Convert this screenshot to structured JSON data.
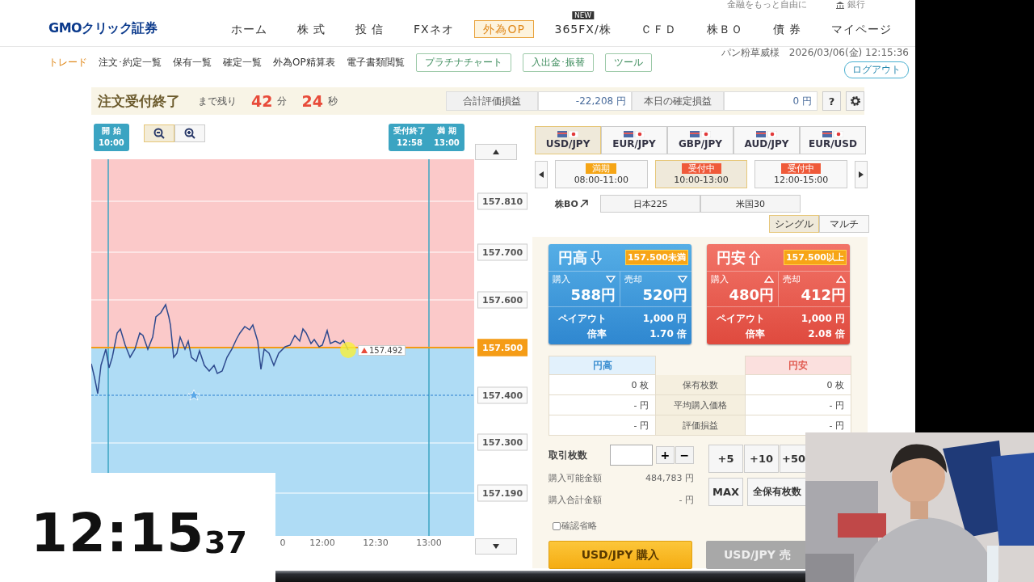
{
  "top_strip": {
    "tagline": "金融をもっと自由に",
    "bank_link": "銀行"
  },
  "header": {
    "logo": "GMOクリック証券",
    "nav": [
      {
        "label": "ホーム",
        "selected": false
      },
      {
        "label": "株 式",
        "selected": false
      },
      {
        "label": "投 信",
        "selected": false
      },
      {
        "label": "FXネオ",
        "selected": false
      },
      {
        "label": "外為OP",
        "selected": true
      },
      {
        "label": "365FX/株",
        "selected": false,
        "badge": "NEW"
      },
      {
        "label": "ＣＦＤ",
        "selected": false
      },
      {
        "label": "株ＢＯ",
        "selected": false
      },
      {
        "label": "債 券",
        "selected": false
      },
      {
        "label": "マイページ",
        "selected": false
      }
    ]
  },
  "subnav": {
    "items": [
      {
        "label": "トレード",
        "selected": true
      },
      {
        "label": "注文･約定一覧",
        "selected": false
      },
      {
        "label": "保有一覧",
        "selected": false
      },
      {
        "label": "確定一覧",
        "selected": false
      },
      {
        "label": "外為OP精算表",
        "selected": false
      },
      {
        "label": "電子書類閲覧",
        "selected": false
      }
    ],
    "buttons": [
      "プラチナチャート",
      "入出金･振替",
      "ツール"
    ],
    "user": "パン粉草威様",
    "datetime": "2026/03/06(金) 12:15:36",
    "logout": "ログアウト"
  },
  "status": {
    "title": "注文受付終了",
    "remaining_label": "まで残り",
    "minutes": "42",
    "minutes_unit": "分",
    "seconds": "24",
    "seconds_unit": "秒",
    "total_pl_label": "合計評価損益",
    "total_pl": "-22,208 円",
    "today_pl_label": "本日の確定損益",
    "today_pl": "0 円",
    "help": "?"
  },
  "chart": {
    "start_flag": {
      "title": "開 始",
      "time": "10:00"
    },
    "end_flag": {
      "title": "受付終了",
      "time": "12:58",
      "title2": "満 期",
      "time2": "13:00"
    },
    "y_labels": [
      {
        "label": "157.810",
        "highlight": false
      },
      {
        "label": "157.700",
        "highlight": false
      },
      {
        "label": "157.600",
        "highlight": false
      },
      {
        "label": "157.500",
        "highlight": true
      },
      {
        "label": "157.400",
        "highlight": false
      },
      {
        "label": "157.300",
        "highlight": false
      },
      {
        "label": "157.190",
        "highlight": false
      }
    ],
    "x_labels": [
      "0",
      "12:00",
      "12:30",
      "13:00"
    ],
    "current_price": "157.492"
  },
  "pairs": [
    {
      "label": "USD/JPY",
      "selected": true
    },
    {
      "label": "EUR/JPY",
      "selected": false
    },
    {
      "label": "GBP/JPY",
      "selected": false
    },
    {
      "label": "AUD/JPY",
      "selected": false
    },
    {
      "label": "EUR/USD",
      "selected": false
    }
  ],
  "sessions": [
    {
      "status": "満期",
      "time": "08:00-11:00",
      "kind": "expired",
      "selected": false
    },
    {
      "status": "受付中",
      "time": "10:00-13:00",
      "kind": "open",
      "selected": true
    },
    {
      "status": "受付中",
      "time": "12:00-15:00",
      "kind": "open",
      "selected": false
    }
  ],
  "stock_bo": {
    "label": "株BO",
    "buttons": [
      "日本225",
      "米国30"
    ]
  },
  "modes": [
    {
      "label": "シングル",
      "selected": true
    },
    {
      "label": "マルチ",
      "selected": false
    }
  ],
  "cards": [
    {
      "kind": "high",
      "title": "円高",
      "threshold": "157.500未満",
      "buy_label": "購入",
      "buy_price": "588円",
      "sell_label": "売却",
      "sell_price": "520円",
      "payout_label": "ペイアウト",
      "payout": "1,000 円",
      "rate_label": "倍率",
      "rate": "1.70 倍"
    },
    {
      "kind": "low",
      "title": "円安",
      "threshold": "157.500以上",
      "buy_label": "購入",
      "buy_price": "480円",
      "sell_label": "売却",
      "sell_price": "412円",
      "payout_label": "ペイアウト",
      "payout": "1,000 円",
      "rate_label": "倍率",
      "rate": "2.08 倍"
    }
  ],
  "positions": {
    "left_header": "円高",
    "right_header": "円安",
    "rows": [
      {
        "left": "0 枚",
        "label": "保有枚数",
        "right": "0 枚"
      },
      {
        "left": "- 円",
        "label": "平均購入価格",
        "right": "- 円"
      },
      {
        "left": "- 円",
        "label": "評価損益",
        "right": "- 円"
      }
    ]
  },
  "order": {
    "qty_label": "取引枚数",
    "plus": "+",
    "minus": "−",
    "quick": [
      "+5",
      "+10",
      "+50"
    ],
    "max": "MAX",
    "all": "全保有枚数",
    "available_label": "購入可能金額",
    "available": "484,783 円",
    "total_label": "購入合計金額",
    "total": "- 円",
    "skip_confirm": {
      "label": "確認省略",
      "checked": false
    },
    "buy_button": "USD/JPY 購入",
    "sell_button": "USD/JPY 売"
  },
  "clock": {
    "hm": "12:15",
    "sec": "37"
  }
}
